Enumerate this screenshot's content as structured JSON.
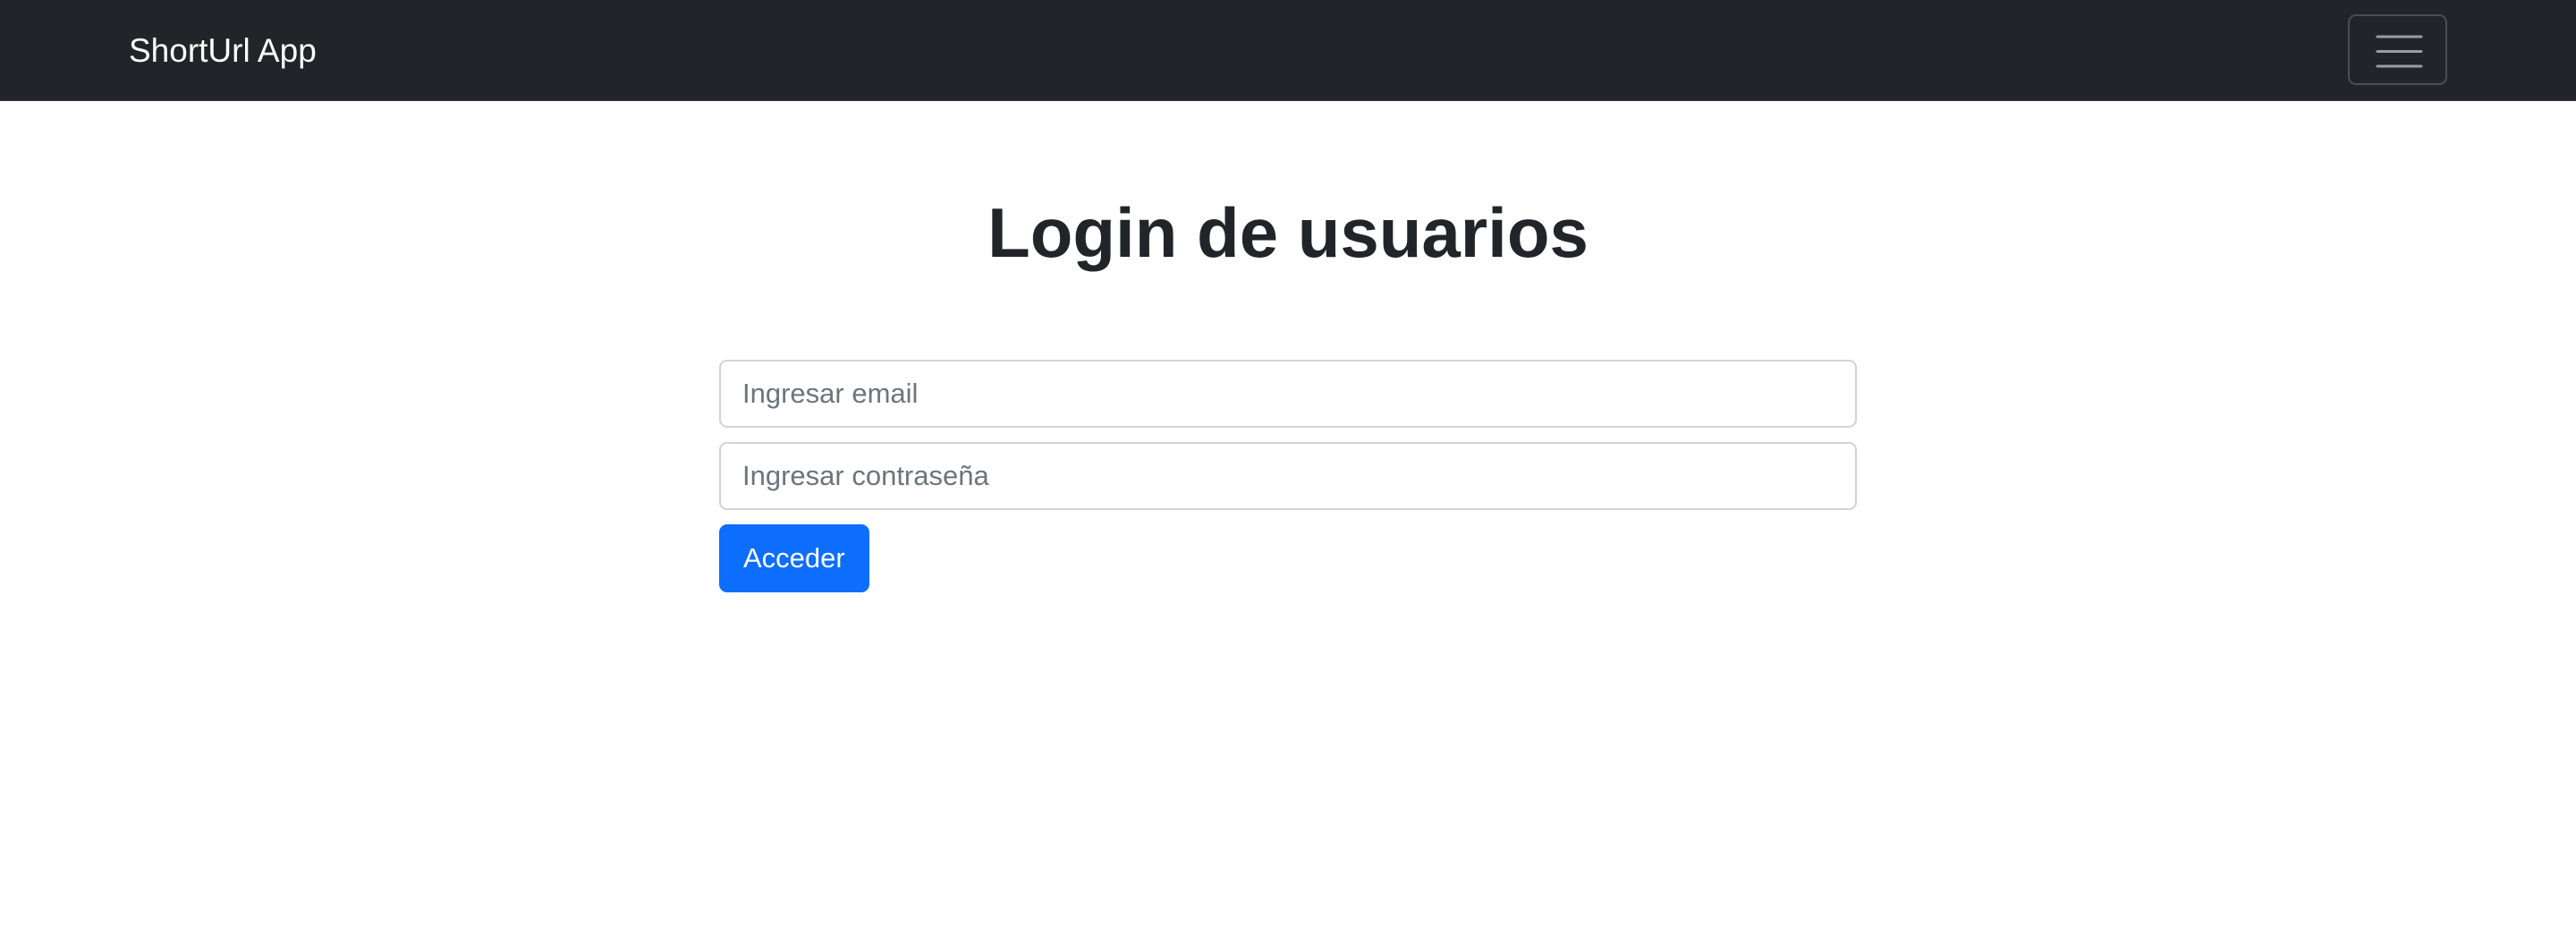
{
  "navbar": {
    "brand": "ShortUrl App",
    "toggler_icon": "hamburger-menu-icon"
  },
  "main": {
    "title": "Login de usuarios",
    "form": {
      "email_placeholder": "Ingresar email",
      "email_value": "",
      "password_placeholder": "Ingresar contraseña",
      "password_value": "",
      "submit_label": "Acceder"
    }
  },
  "colors": {
    "navbar_bg": "#212529",
    "primary": "#0d6efd",
    "text": "#212529",
    "placeholder": "#6c757d",
    "input_border": "#ced4da"
  }
}
